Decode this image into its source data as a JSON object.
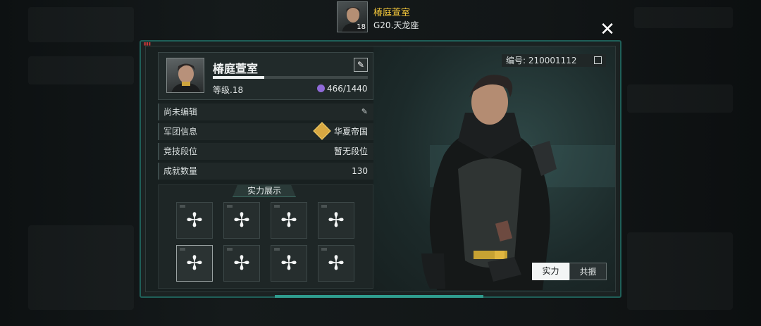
{
  "top_player": {
    "name": "椿庭萱室",
    "level": "18",
    "server": "G20.天龙座"
  },
  "close_label": "✕",
  "uid_text": "编号: 210001112",
  "profile": {
    "name": "椿庭萱室",
    "level_text": "等级.18",
    "power_text": "466/1440",
    "xp_progress": 0.33
  },
  "info_rows": [
    {
      "label": "尚未编辑",
      "value": ""
    },
    {
      "label": "军团信息",
      "value": "华夏帝国"
    },
    {
      "label": "竞技段位",
      "value": "暂无段位"
    },
    {
      "label": "成就数量",
      "value": "130"
    }
  ],
  "showcase": {
    "title": "实力展示",
    "slot_symbol": "✢"
  },
  "tabs": [
    {
      "label": "实力",
      "active": true
    },
    {
      "label": "共振",
      "active": false
    }
  ],
  "colors": {
    "accent": "#2f9d8e",
    "gold_name": "#f0c43a",
    "power_gem": "#8f6ad8",
    "legion_badge": "#d8a842"
  }
}
